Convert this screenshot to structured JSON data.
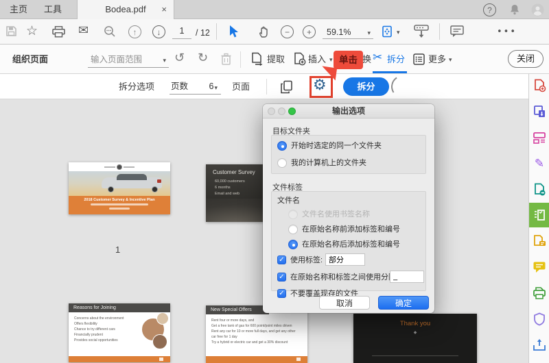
{
  "colors": {
    "accent_blue": "#1877e6",
    "annotation_red": "#e2402c",
    "tool_selected_green": "#74b944",
    "slide_orange": "#dd7f37",
    "ok_button_blue": "#2f7cf6"
  },
  "icons": {
    "check": "✓",
    "chevron_down": "▾",
    "scissors": "✂",
    "gear": "⚙",
    "undo": "↺",
    "redo": "↻",
    "ellipsis": "•••",
    "help": "?",
    "star": "☆",
    "mail": "✉",
    "minus": "−",
    "plus": "+",
    "arrow_up": "↑",
    "arrow_down": "↓",
    "close_tab": "×",
    "diamond": "◆"
  },
  "tabbar": {
    "home": "主页",
    "tools": "工具",
    "doc_tab": "Bodea.pdf"
  },
  "toolbar": {
    "page_current": "1",
    "page_total": "/ 12",
    "zoom_level": "59.1%"
  },
  "organize_bar": {
    "title": "组织页面",
    "range_placeholder": "输入页面范围",
    "extract": "提取",
    "insert": "插入",
    "replace_partial": "换",
    "split": "拆分",
    "more": "更多",
    "close": "关闭"
  },
  "callout": {
    "label": "单击"
  },
  "split_bar": {
    "options_label": "拆分选项",
    "mode_value": "页数",
    "count_value": "6",
    "unit_label": "页面",
    "split_button": "拆分"
  },
  "dialog": {
    "title": "输出选项",
    "target_section": {
      "label": "目标文件夹",
      "option_same_folder": "开始时选定的同一个文件夹",
      "option_my_computer": "我的计算机上的文件夹",
      "selected": "option_same_folder"
    },
    "file_label_section": {
      "label": "文件标签",
      "filename_label": "文件名",
      "option_bookmark_names": "文件名使用书签名称",
      "option_prefix": "在原始名称前添加标签和编号",
      "option_suffix": "在原始名称后添加标签和编号",
      "selected": "option_suffix",
      "use_label_checkbox": "使用标签:",
      "use_label_value": "部分",
      "separator_checkbox": "在原始名称和标签之间使用分隔符:",
      "separator_value": "_",
      "no_overwrite_checkbox": "不要覆盖现存的文件"
    },
    "buttons": {
      "cancel": "取消",
      "ok": "确定"
    }
  },
  "thumbnails": {
    "page1": {
      "title": "2018 Customer Survey & Incentive Plan",
      "page_number": "1"
    },
    "page2": {
      "title": "Customer Survey",
      "bullets": [
        "60,000 customers",
        "6 months",
        "Email and web"
      ]
    },
    "page4": {
      "title": "Reasons for Joining",
      "bullets": [
        "Concerns about the environment",
        "Offers flexibility",
        "Chance to try different cars",
        "Financially prudent",
        "Provides social opportunities"
      ]
    },
    "page5": {
      "title": "New Special Offers",
      "bullets": [
        "Rent four or more days, and",
        "Get a free tank of gas for 600 point/point miles driven",
        "Rent any car for 10 or more full days, and get any other car free for 1 day",
        "Try a hybrid or electric car and get a 30% discount"
      ]
    },
    "page6": {
      "title": "Thank you"
    }
  },
  "sidebar": {
    "tools": [
      "create-pdf",
      "export-pdf",
      "edit-pdf",
      "fill-and-sign",
      "send-pdf",
      "organize-pages",
      "combine-files",
      "comment",
      "scan-ocr",
      "protect",
      "share"
    ]
  }
}
